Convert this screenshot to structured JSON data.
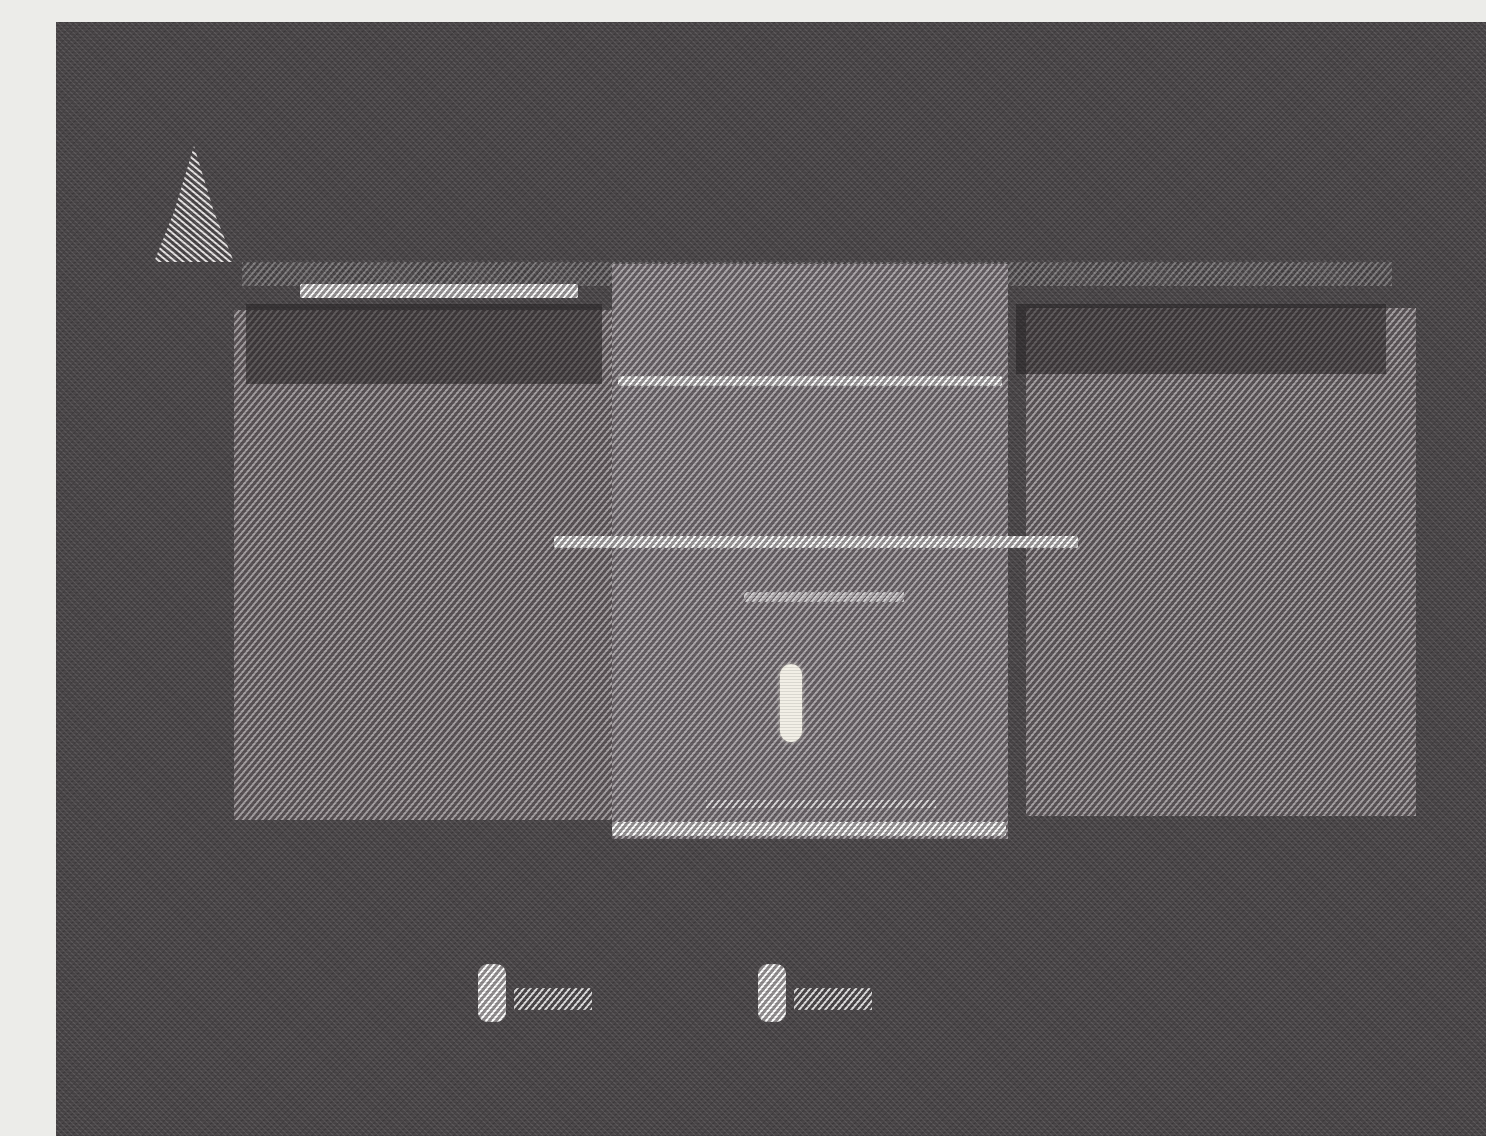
{
  "scene": {
    "description_type": "atari-style adventure room",
    "colors": {
      "screen_background": "#4b4749",
      "room_walls": "#6c6468",
      "center_room": "#7a7277",
      "wall_lines": "#d9d6d7",
      "player": "#f2efe6",
      "frame": "#ecece9"
    }
  },
  "icons": {
    "arrow": "arrow-up-icon",
    "player": "player-marker"
  },
  "hud": {
    "indicators": [
      {
        "name": "inventory-slot-1"
      },
      {
        "name": "inventory-slot-2"
      }
    ]
  }
}
